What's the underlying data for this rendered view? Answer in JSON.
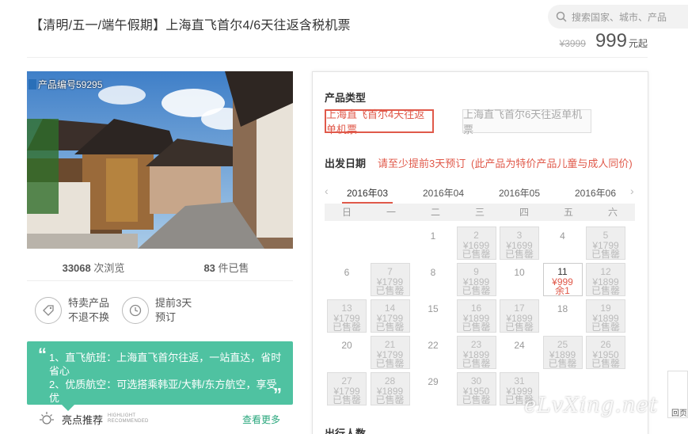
{
  "header": {
    "title": "【清明/五一/端午假期】上海直飞首尔4/6天往返含税机票",
    "search_placeholder": "搜索国家、城市、产品",
    "price_original": "¥3999",
    "price_now": "999",
    "price_unit": "元起"
  },
  "photo": {
    "product_id": "产品编号59295"
  },
  "stats": {
    "views": "33068",
    "views_label": "次浏览",
    "sold": "83",
    "sold_label": "件已售"
  },
  "features": [
    {
      "line1": "特卖产品",
      "line2": "不退不换",
      "icon": "tag-icon"
    },
    {
      "line1": "提前3天",
      "line2": "预订",
      "icon": "clock-icon"
    }
  ],
  "highlight_box": {
    "line1": "1、直飞航班：上海直飞首尔往返，一站直达，省时",
    "line2": "省心",
    "line3": "2、优质航空：可选搭乘韩亚/大韩/东方航空，享受优",
    "color": "#4fc2a1"
  },
  "highlight_footer": {
    "title": "亮点推荐",
    "sub1": "HIGHLIGHT",
    "sub2": "RECOMMENDED",
    "more": "查看更多"
  },
  "booking": {
    "product_type_label": "产品类型",
    "options": [
      "上海直飞首尔4天往返单机票",
      "上海直飞首尔6天往返单机票"
    ],
    "date_label": "出发日期",
    "advance_note": "请至少提前3天预订",
    "child_note": "(此产品为特价产品儿童与成人同价)",
    "months": [
      "2016年03",
      "2016年04",
      "2016年05",
      "2016年06"
    ],
    "weekdays": [
      "日",
      "一",
      "二",
      "三",
      "四",
      "五",
      "六"
    ],
    "travelers_label": "出行人数",
    "accent": "#e0594a"
  },
  "calendar": [
    {
      "day": "1",
      "state": "plain"
    },
    {
      "day": "2",
      "price": "¥1699",
      "status": "已售罄",
      "state": "avail"
    },
    {
      "day": "3",
      "price": "¥1699",
      "status": "已售罄",
      "state": "avail"
    },
    {
      "day": "4",
      "state": "plain"
    },
    {
      "day": "5",
      "price": "¥1799",
      "status": "已售罄",
      "state": "avail"
    },
    {
      "day": "6",
      "state": "plain"
    },
    {
      "day": "7",
      "price": "¥1799",
      "status": "已售罄",
      "state": "avail"
    },
    {
      "day": "8",
      "state": "plain"
    },
    {
      "day": "9",
      "price": "¥1899",
      "status": "已售罄",
      "state": "avail"
    },
    {
      "day": "10",
      "state": "plain"
    },
    {
      "day": "11",
      "price": "¥999",
      "status": "余1",
      "state": "sel"
    },
    {
      "day": "12",
      "price": "¥1899",
      "status": "已售罄",
      "state": "avail"
    },
    {
      "day": "13",
      "price": "¥1799",
      "status": "已售罄",
      "state": "avail"
    },
    {
      "day": "14",
      "price": "¥1799",
      "status": "已售罄",
      "state": "avail"
    },
    {
      "day": "15",
      "state": "plain"
    },
    {
      "day": "16",
      "price": "¥1899",
      "status": "已售罄",
      "state": "avail"
    },
    {
      "day": "17",
      "price": "¥1899",
      "status": "已售罄",
      "state": "avail"
    },
    {
      "day": "18",
      "state": "plain"
    },
    {
      "day": "19",
      "price": "¥1899",
      "status": "已售罄",
      "state": "avail"
    },
    {
      "day": "20",
      "state": "plain"
    },
    {
      "day": "21",
      "price": "¥1799",
      "status": "已售罄",
      "state": "avail"
    },
    {
      "day": "22",
      "state": "plain"
    },
    {
      "day": "23",
      "price": "¥1899",
      "status": "已售罄",
      "state": "avail"
    },
    {
      "day": "24",
      "state": "plain"
    },
    {
      "day": "25",
      "price": "¥1899",
      "status": "已售罄",
      "state": "avail"
    },
    {
      "day": "26",
      "price": "¥1950",
      "status": "已售罄",
      "state": "avail"
    },
    {
      "day": "27",
      "price": "¥1799",
      "status": "已售罄",
      "state": "avail"
    },
    {
      "day": "28",
      "price": "¥1899",
      "status": "已售罄",
      "state": "avail"
    },
    {
      "day": "29",
      "state": "plain"
    },
    {
      "day": "30",
      "price": "¥1950",
      "status": "已售罄",
      "state": "avail"
    },
    {
      "day": "31",
      "price": "¥1999",
      "status": "已售罄",
      "state": "avail"
    }
  ],
  "side_tab": "回页",
  "watermark": "eLvXing.net"
}
